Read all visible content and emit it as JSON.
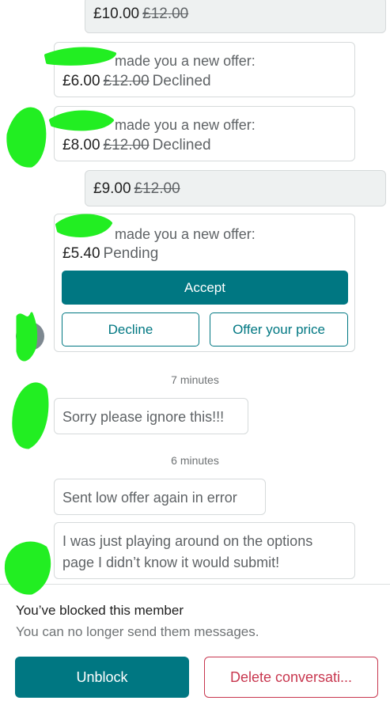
{
  "messages": {
    "m1": {
      "price": "£10.00",
      "old_price": "£12.00"
    },
    "m2": {
      "sender": "made you a new offer:",
      "price": "£6.00",
      "old_price": "£12.00",
      "status": "Declined"
    },
    "m3": {
      "sender": "made you a new offer:",
      "price": "£8.00",
      "old_price": "£12.00",
      "status": "Declined"
    },
    "m4": {
      "price": "£9.00",
      "old_price": "£12.00"
    },
    "m5": {
      "sender": "made you a new offer:",
      "price": "£5.40",
      "status": "Pending",
      "accept_label": "Accept",
      "decline_label": "Decline",
      "offer_label": "Offer your price"
    },
    "ts1": "7 minutes",
    "m6": {
      "text": "Sorry please ignore this!!!"
    },
    "ts2": "6 minutes",
    "m7": {
      "text": "Sent low offer again in error"
    },
    "m8": {
      "line1": "I was just playing around on the options",
      "line2": "page I didn’t know it would submit!"
    }
  },
  "blocked": {
    "title": "You’ve blocked this member",
    "subtitle": "You can no longer send them messages.",
    "unblock_label": "Unblock",
    "delete_label": "Delete conversati..."
  },
  "colors": {
    "accent": "#007782",
    "danger": "#c8374f",
    "redaction": "#22ee22"
  }
}
